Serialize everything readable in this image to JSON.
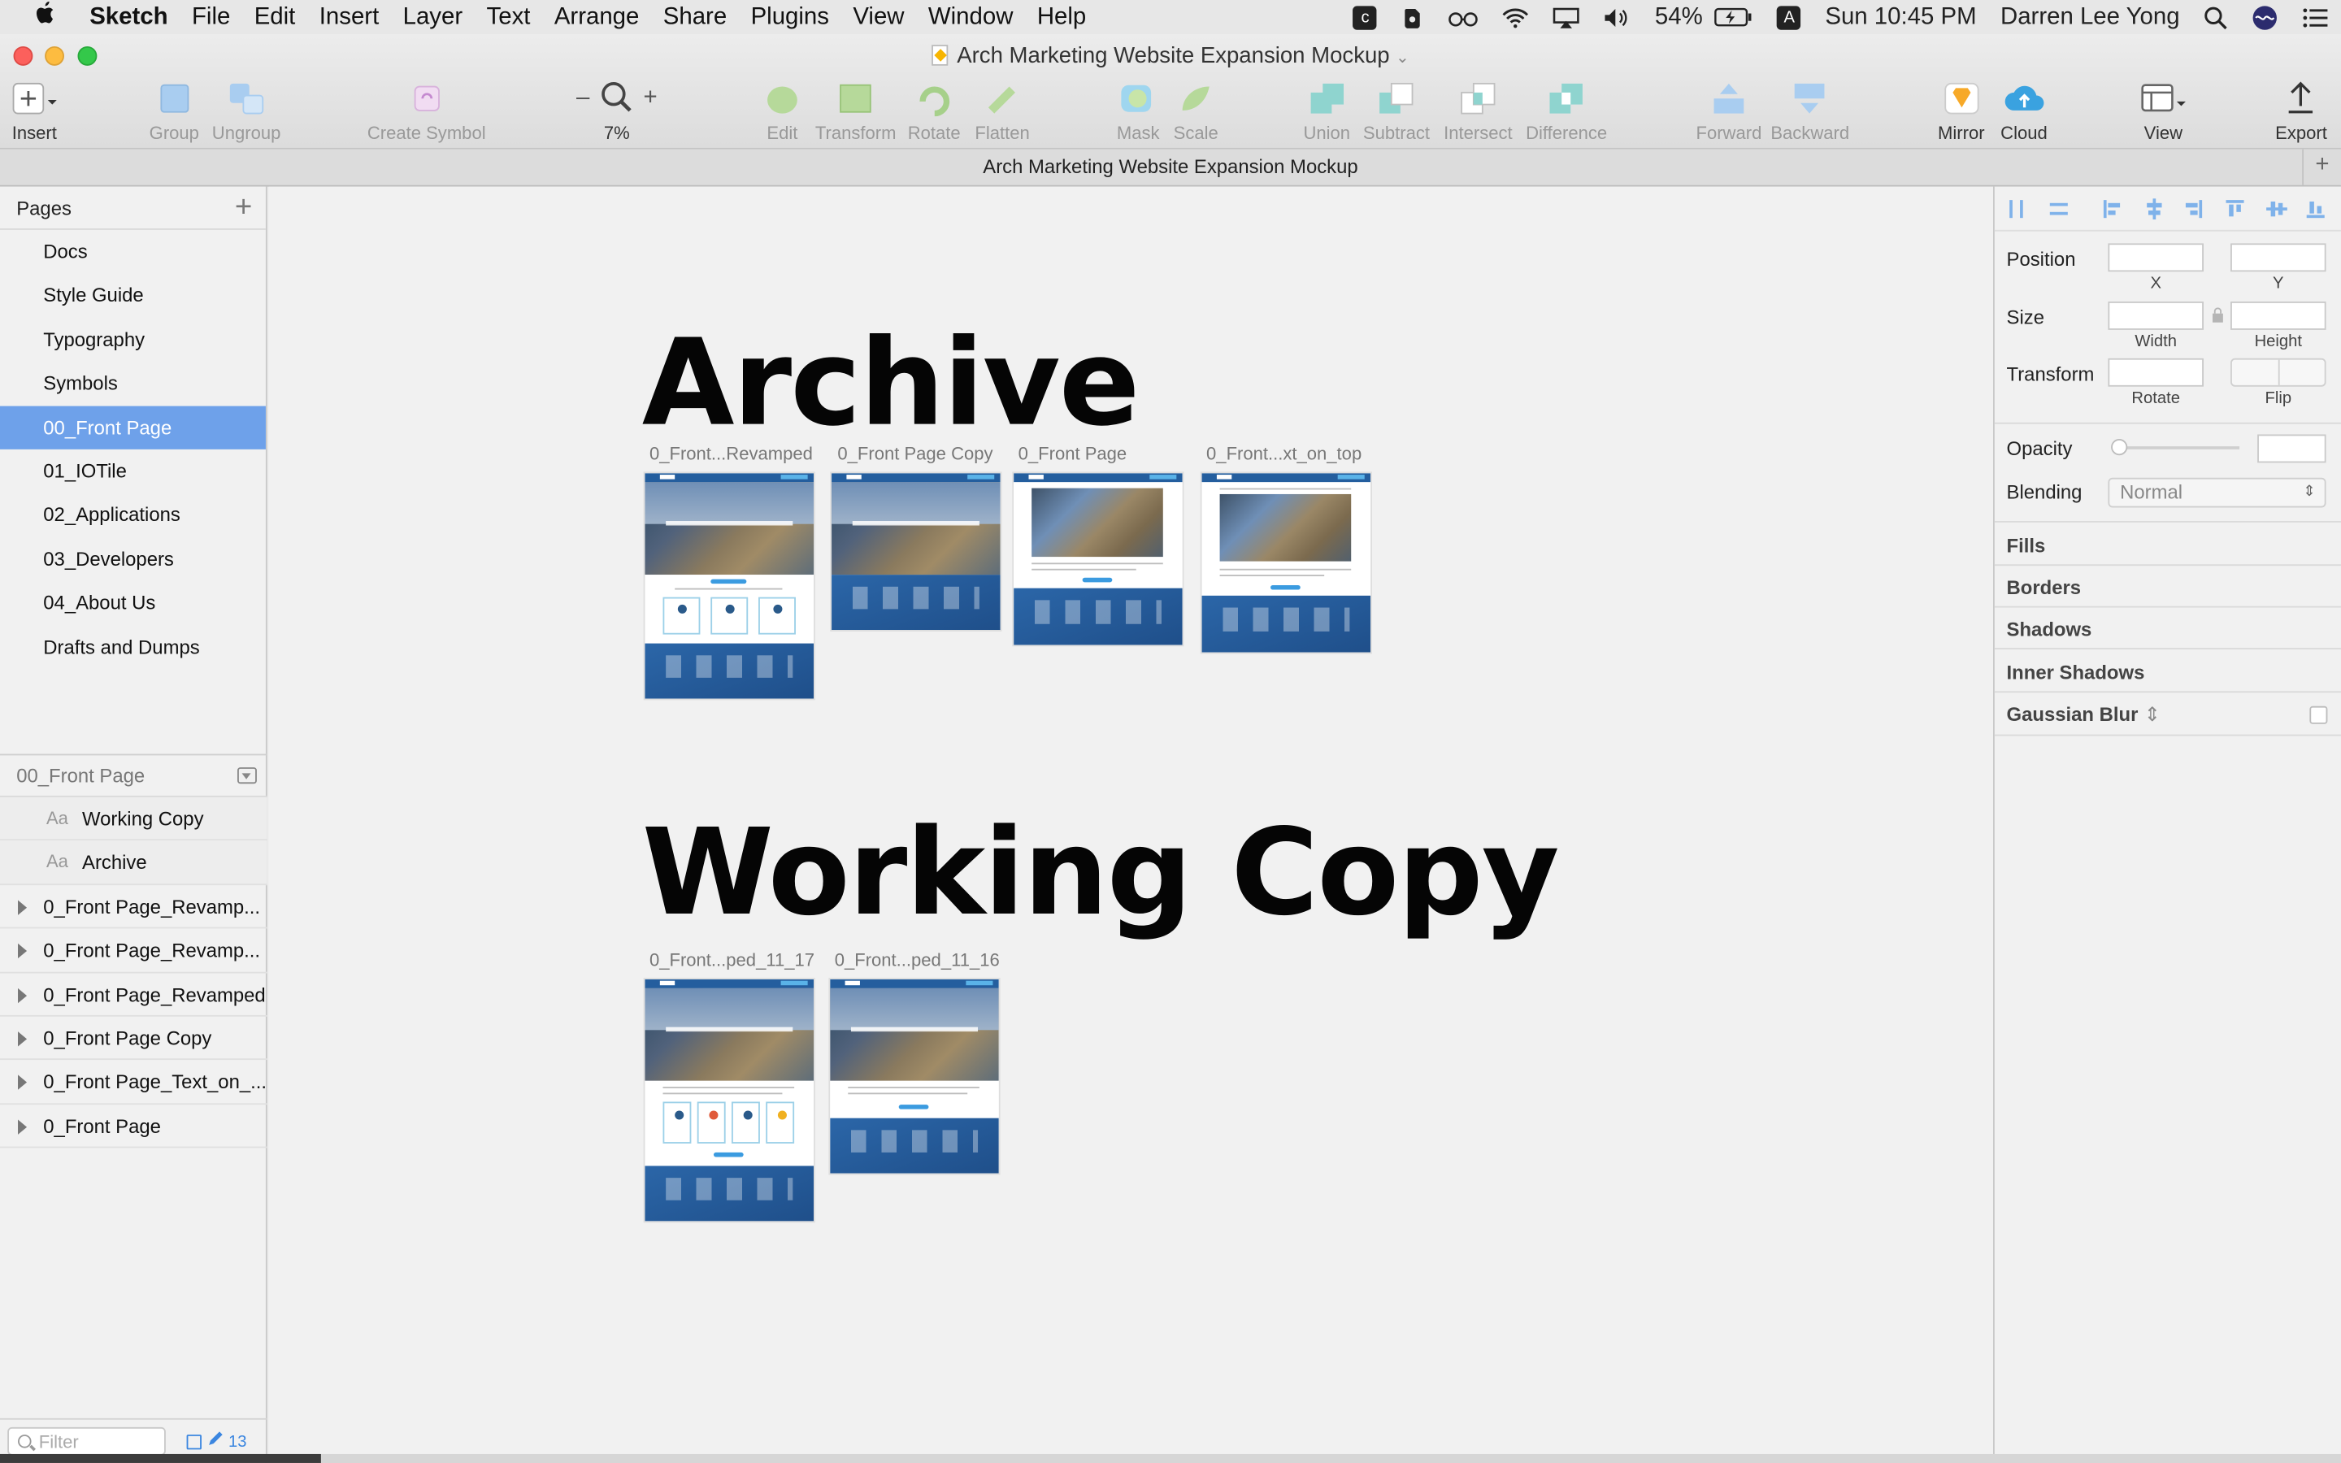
{
  "menubar": {
    "apple_icon": "apple-icon",
    "app_name": "Sketch",
    "menus": [
      "File",
      "Edit",
      "Insert",
      "Layer",
      "Text",
      "Arrange",
      "Share",
      "Plugins",
      "View",
      "Window",
      "Help"
    ],
    "battery": "54%",
    "clock": "Sun 10:45 PM",
    "user": "Darren Lee Yong",
    "input_source": "A"
  },
  "window": {
    "title": "Arch Marketing Website Expansion Mockup",
    "tab_title": "Arch Marketing Website Expansion Mockup"
  },
  "toolbar": {
    "insert": "Insert",
    "group": "Group",
    "ungroup": "Ungroup",
    "create_symbol": "Create Symbol",
    "zoom_minus": "–",
    "zoom_plus": "+",
    "zoom_level": "7%",
    "edit": "Edit",
    "transform": "Transform",
    "rotate": "Rotate",
    "flatten": "Flatten",
    "mask": "Mask",
    "scale": "Scale",
    "union": "Union",
    "subtract": "Subtract",
    "intersect": "Intersect",
    "difference": "Difference",
    "forward": "Forward",
    "backward": "Backward",
    "mirror": "Mirror",
    "cloud": "Cloud",
    "view": "View",
    "export": "Export"
  },
  "sidebar": {
    "pages_header": "Pages",
    "pages": [
      {
        "label": "Docs"
      },
      {
        "label": "Style Guide"
      },
      {
        "label": "Typography"
      },
      {
        "label": "Symbols"
      },
      {
        "label": "00_Front Page",
        "selected": true
      },
      {
        "label": "01_IOTile"
      },
      {
        "label": "02_Applications"
      },
      {
        "label": "03_Developers"
      },
      {
        "label": "04_About Us"
      },
      {
        "label": "Drafts and Dumps"
      }
    ],
    "layers_header": "00_Front Page",
    "text_layer_badge": "Aa",
    "text_layers": [
      "Working Copy",
      "Archive"
    ],
    "group_layers": [
      "0_Front Page_Revamp...",
      "0_Front Page_Revamp...",
      "0_Front Page_Revamped",
      "0_Front Page Copy",
      "0_Front Page_Text_on_...",
      "0_Front Page"
    ],
    "filter_placeholder": "Filter",
    "layer_count": "13"
  },
  "canvas": {
    "archive_title": "Archive",
    "working_title": "Working Copy",
    "archive_artboards": [
      "0_Front...Revamped",
      "0_Front Page Copy",
      "0_Front Page",
      "0_Front...xt_on_top"
    ],
    "working_artboards": [
      "0_Front...ped_11_17",
      "0_Front...ped_11_16"
    ]
  },
  "inspector": {
    "position": "Position",
    "x": "X",
    "y": "Y",
    "size": "Size",
    "width": "Width",
    "height": "Height",
    "transform": "Transform",
    "rotate": "Rotate",
    "flip": "Flip",
    "opacity": "Opacity",
    "blending": "Blending",
    "blending_value": "Normal",
    "fills": "Fills",
    "borders": "Borders",
    "shadows": "Shadows",
    "inner_shadows": "Inner Shadows",
    "gaussian_blur": "Gaussian Blur"
  },
  "colors": {
    "selection": "#6ea1ea",
    "accent": "#3b86e0",
    "artboard_blue": "#245e9e"
  }
}
